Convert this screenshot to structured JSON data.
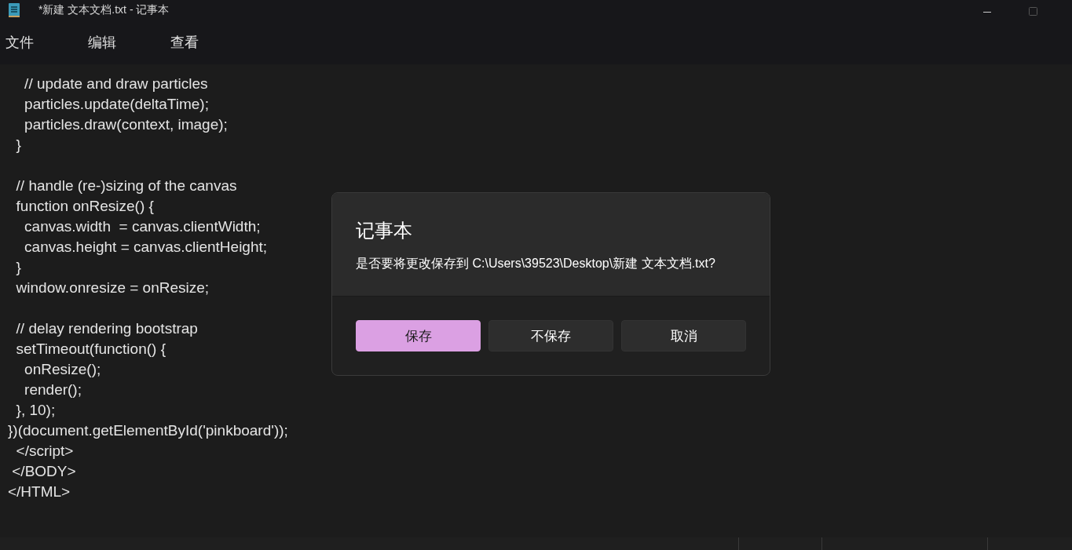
{
  "window": {
    "title": "*新建 文本文档.txt - 记事本"
  },
  "menu": [
    {
      "label": "文件"
    },
    {
      "label": "编辑"
    },
    {
      "label": "查看"
    }
  ],
  "editor": {
    "blocks": [
      [
        "    // update and draw particles",
        "    particles.update(deltaTime);",
        "    particles.draw(context, image);",
        "  }"
      ],
      [
        "  // handle (re-)sizing of the canvas",
        "  function onResize() {",
        "    canvas.width  = canvas.clientWidth;",
        "    canvas.height = canvas.clientHeight;",
        "  }",
        "  window.onresize = onResize;"
      ],
      [
        "  // delay rendering bootstrap",
        "  setTimeout(function() {",
        "    onResize();",
        "    render();",
        "  }, 10);",
        "})(document.getElementById('pinkboard'));",
        "  </script>",
        " </BODY>",
        "</HTML>"
      ]
    ]
  },
  "dialog": {
    "title": "记事本",
    "message": "是否要将更改保存到 C:\\Users\\39523\\Desktop\\新建 文本文档.txt?",
    "buttons": [
      {
        "label": "保存",
        "kind": "primary"
      },
      {
        "label": "不保存",
        "kind": "secondary"
      },
      {
        "label": "取消",
        "kind": "secondary"
      }
    ]
  }
}
